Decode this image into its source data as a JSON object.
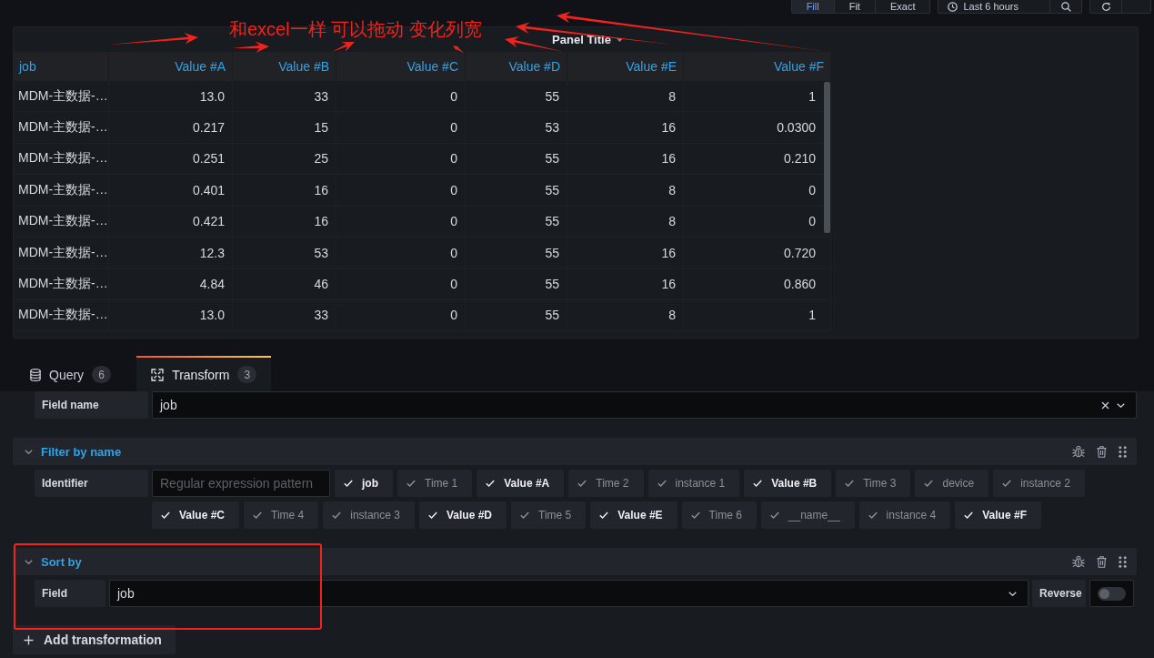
{
  "toolbar": {
    "view_modes": [
      {
        "label": "Fill",
        "selected": true
      },
      {
        "label": "Fit",
        "selected": false
      },
      {
        "label": "Exact",
        "selected": false
      }
    ],
    "time_range": "Last 6 hours"
  },
  "annotation": {
    "text": "和excel一样 可以拖动 变化列宽"
  },
  "panel": {
    "title": "Panel Title",
    "table": {
      "columns": [
        "job",
        "Value #A",
        "Value #B",
        "Value #C",
        "Value #D",
        "Value #E",
        "Value #F"
      ],
      "rows": [
        [
          "MDM-主数据-…",
          "13.0",
          "33",
          "0",
          "55",
          "8",
          "1"
        ],
        [
          "MDM-主数据-…",
          "0.217",
          "15",
          "0",
          "53",
          "16",
          "0.0300"
        ],
        [
          "MDM-主数据-…",
          "0.251",
          "25",
          "0",
          "55",
          "16",
          "0.210"
        ],
        [
          "MDM-主数据-…",
          "0.401",
          "16",
          "0",
          "55",
          "8",
          "0"
        ],
        [
          "MDM-主数据-…",
          "0.421",
          "16",
          "0",
          "55",
          "8",
          "0"
        ],
        [
          "MDM-主数据-…",
          "12.3",
          "53",
          "0",
          "55",
          "16",
          "0.720"
        ],
        [
          "MDM-主数据-…",
          "4.84",
          "46",
          "0",
          "55",
          "16",
          "0.860"
        ],
        [
          "MDM-主数据-…",
          "13.0",
          "33",
          "0",
          "55",
          "8",
          "1"
        ]
      ]
    }
  },
  "editor_tabs": [
    {
      "label": "Query",
      "count": "6",
      "selected": false
    },
    {
      "label": "Transform",
      "count": "3",
      "selected": true
    }
  ],
  "field_name": {
    "label": "Field name",
    "value": "job"
  },
  "transformations": [
    {
      "kind": "filter",
      "title": "Filter by name",
      "expanded": true,
      "label": "Identifier",
      "placeholder": "Regular expression pattern",
      "options": [
        {
          "label": "job",
          "checked": true
        },
        {
          "label": "Time 1",
          "checked": false
        },
        {
          "label": "Value #A",
          "checked": true
        },
        {
          "label": "Time 2",
          "checked": false
        },
        {
          "label": "instance 1",
          "checked": false
        },
        {
          "label": "Value #B",
          "checked": true
        },
        {
          "label": "Time 3",
          "checked": false
        },
        {
          "label": "device",
          "checked": false
        },
        {
          "label": "instance 2",
          "checked": false
        },
        {
          "label": "Value #C",
          "checked": true
        },
        {
          "label": "Time 4",
          "checked": false
        },
        {
          "label": "instance 3",
          "checked": false
        },
        {
          "label": "Value #D",
          "checked": true
        },
        {
          "label": "Time 5",
          "checked": false
        },
        {
          "label": "Value #E",
          "checked": true
        },
        {
          "label": "Time 6",
          "checked": false
        },
        {
          "label": "__name__",
          "checked": false
        },
        {
          "label": "instance 4",
          "checked": false
        },
        {
          "label": "Value #F",
          "checked": true
        }
      ]
    },
    {
      "kind": "sort",
      "title": "Sort by",
      "expanded": true,
      "label": "Field",
      "value": "job",
      "reverse_label": "Reverse",
      "reverse": false
    }
  ],
  "add_button": "Add transformation"
}
